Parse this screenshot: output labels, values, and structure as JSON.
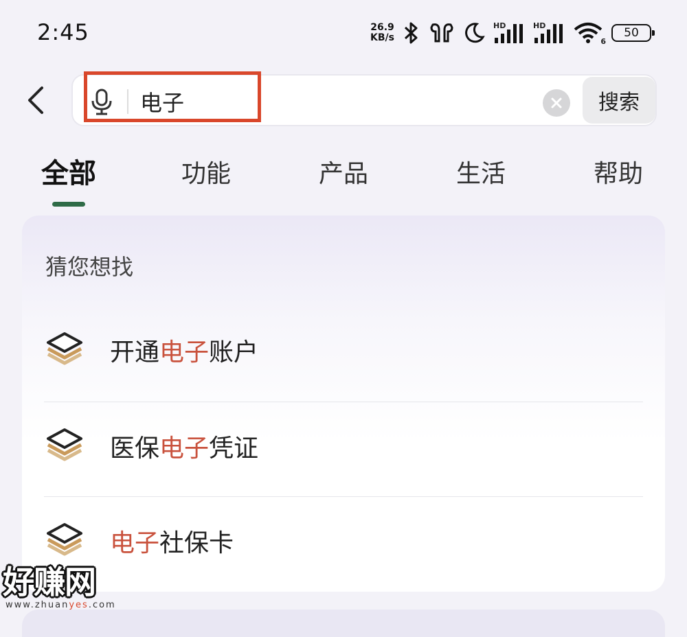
{
  "status_bar": {
    "time": "2:45",
    "net_speed_value": "26.9",
    "net_speed_unit": "KB/s",
    "icons": [
      "bluetooth-icon",
      "earbuds-icon",
      "moon-icon",
      "signal-hd-icon",
      "signal-hd-icon",
      "wifi-icon"
    ],
    "signal_label_1": "HD",
    "signal_label_2": "HD",
    "wifi_band": "6",
    "battery": "50"
  },
  "search": {
    "query": "电子",
    "button_label": "搜索"
  },
  "tabs": [
    {
      "label": "全部",
      "active": true
    },
    {
      "label": "功能",
      "active": false
    },
    {
      "label": "产品",
      "active": false
    },
    {
      "label": "生活",
      "active": false
    },
    {
      "label": "帮助",
      "active": false
    }
  ],
  "suggestions": {
    "title": "猜您想找",
    "items": [
      {
        "before": "开通",
        "highlight": "电子",
        "after": "账户"
      },
      {
        "before": "医保",
        "highlight": "电子",
        "after": "凭证"
      },
      {
        "before": "",
        "highlight": "电子",
        "after": "社保卡"
      }
    ]
  },
  "colors": {
    "highlight_text": "#c9523d",
    "annotation_box": "#d9472b",
    "tab_indicator": "#2e6b47"
  },
  "watermark": {
    "main": "好赚网",
    "url_prefix": "www.zhuan",
    "url_mid": "yes",
    "url_suffix": ".com"
  }
}
